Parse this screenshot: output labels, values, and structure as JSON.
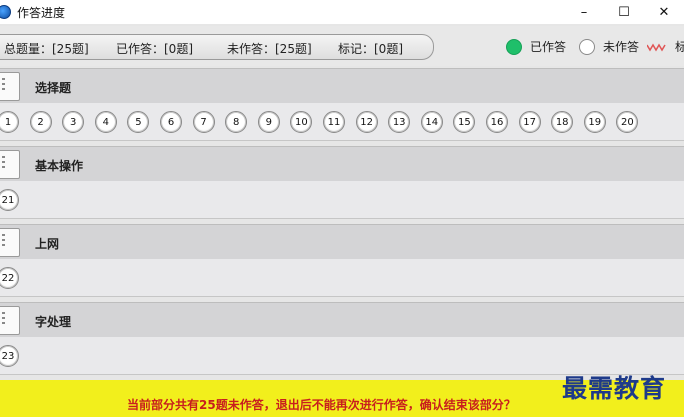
{
  "window": {
    "title": "作答进度",
    "minimize": "–",
    "maximize": "☐",
    "close": "✕"
  },
  "summary": {
    "total": "总题量：[25题]",
    "answered": "已作答：[0题]",
    "unanswered": "未作答：[25题]",
    "marked": "标记：[0题]"
  },
  "legend": [
    {
      "label": "已作答",
      "color": "#1fbf6a"
    },
    {
      "label": "未作答",
      "color": "#ffffff"
    },
    {
      "label": "标",
      "color": "#e05555"
    }
  ],
  "sections": [
    {
      "title": "选择题",
      "questions": [
        "1",
        "2",
        "3",
        "4",
        "5",
        "6",
        "7",
        "8",
        "9",
        "10",
        "11",
        "12",
        "13",
        "14",
        "15",
        "16",
        "17",
        "18",
        "19",
        "20"
      ]
    },
    {
      "title": "基本操作",
      "questions": [
        "21"
      ]
    },
    {
      "title": "上网",
      "questions": [
        "22"
      ]
    },
    {
      "title": "字处理",
      "questions": [
        "23"
      ]
    }
  ],
  "footer": {
    "message": "当前部分共有25题未作答，退出后不能再次进行作答，确认结束该部分？"
  },
  "watermark": "最需教育"
}
